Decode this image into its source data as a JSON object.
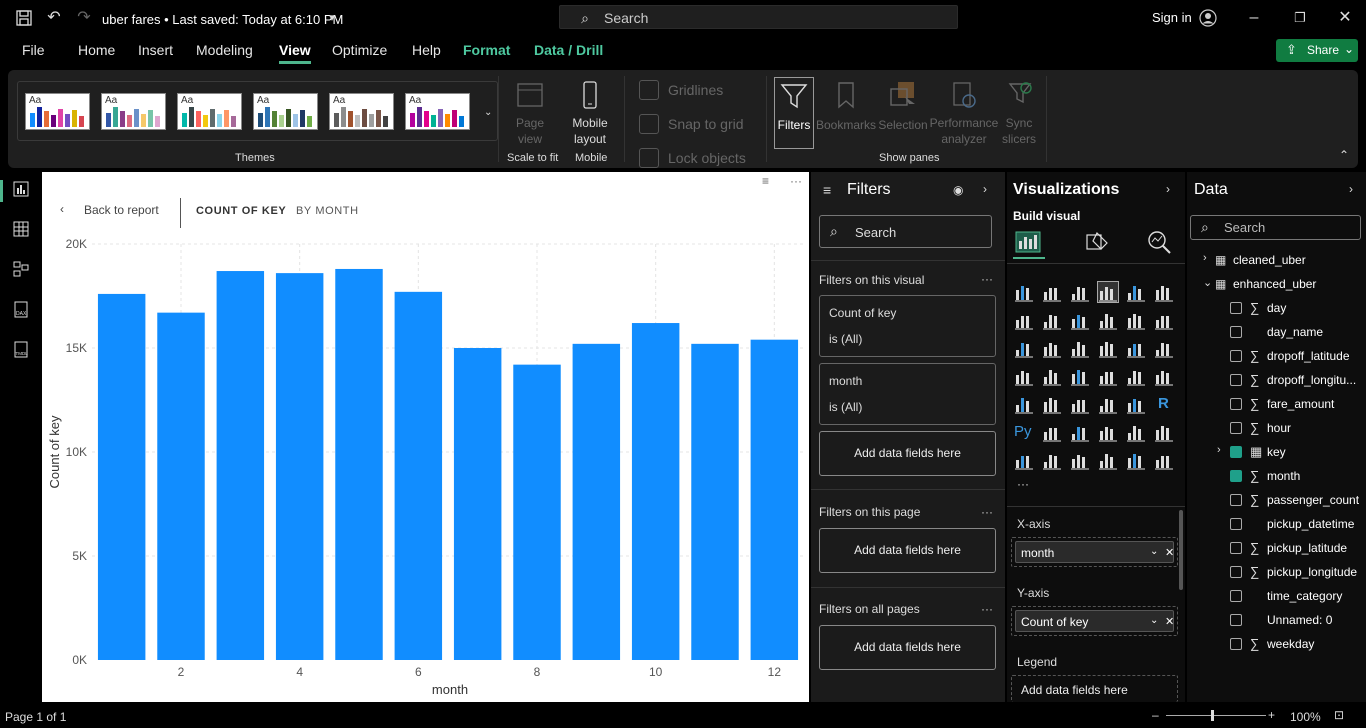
{
  "titlebar": {
    "doc_title": "uber fares • Last saved: Today at 6:10 PM",
    "search_placeholder": "Search",
    "sign_in": "Sign in"
  },
  "menu": {
    "items": [
      "File",
      "Home",
      "Insert",
      "Modeling",
      "View",
      "Optimize",
      "Help",
      "Format",
      "Data / Drill"
    ],
    "active": "View",
    "share": "Share"
  },
  "ribbon": {
    "themes_label": "Themes",
    "scale_label": "Scale to fit",
    "mobile_label": "Mobile",
    "show_panes_label": "Show panes",
    "page_view": "Page view",
    "mobile_layout": "Mobile layout",
    "gridlines": "Gridlines",
    "snap_to_grid": "Snap to grid",
    "lock_objects": "Lock objects",
    "filters": "Filters",
    "bookmarks": "Bookmarks",
    "selection": "Selection",
    "performance_analyzer": "Performance analyzer",
    "sync_slicers": "Sync slicers",
    "theme_swatch_text": "Aa",
    "accent": "#4eb58c"
  },
  "canvas": {
    "back_to_report": "Back to report",
    "title_measure": "COUNT OF KEY",
    "title_by": "BY MONTH"
  },
  "chart_data": {
    "type": "bar",
    "x": [
      1,
      2,
      3,
      4,
      5,
      6,
      7,
      8,
      9,
      10,
      11,
      12
    ],
    "values": [
      17600,
      16700,
      18700,
      18600,
      18800,
      17700,
      15000,
      14200,
      15200,
      16200,
      15200,
      15400
    ],
    "xticks": [
      "2",
      "4",
      "6",
      "8",
      "10",
      "12"
    ],
    "yticks": [
      "0K",
      "5K",
      "10K",
      "15K",
      "20K"
    ],
    "ylim": [
      0,
      20000
    ],
    "xlabel": "month",
    "ylabel": "Count of key",
    "bar_color": "#118dff",
    "grid": true
  },
  "filters": {
    "title": "Filters",
    "search_placeholder": "Search",
    "on_visual": "Filters on this visual",
    "on_page": "Filters on this page",
    "on_all_pages": "Filters on all pages",
    "cards": [
      {
        "name": "Count of key",
        "state": "is (All)"
      },
      {
        "name": "month",
        "state": "is (All)"
      }
    ],
    "add_fields": "Add data fields here",
    "more": "···"
  },
  "visualizations": {
    "title": "Visualizations",
    "build_visual": "Build visual",
    "more": "···",
    "x_axis_label": "X-axis",
    "x_axis_field": "month",
    "y_axis_label": "Y-axis",
    "y_axis_field": "Count of key",
    "legend_label": "Legend",
    "add_fields": "Add data fields here",
    "r_label": "R",
    "py_label": "Py",
    "icons": [
      "stacked-bar-icon",
      "stacked-column-icon",
      "clustered-bar-icon",
      "clustered-column-icon",
      "100-bar-icon",
      "100-column-icon",
      "line-chart-icon",
      "area-chart-icon",
      "stacked-area-icon",
      "ribbon-chart-icon",
      "line-clustered-icon",
      "line-stacked-icon",
      "combo-chart-icon",
      "waterfall-icon",
      "funnel-icon",
      "scatter-icon",
      "pie-icon",
      "donut-icon",
      "treemap-icon",
      "map-icon",
      "filled-map-icon",
      "azure-map-icon",
      "gauge-icon",
      "card-icon",
      "multirow-card-icon",
      "kpi-icon",
      "slicer-icon",
      "table-icon",
      "matrix-icon",
      "r-visual-icon",
      "python-visual-icon",
      "key-influencers-icon",
      "decomposition-tree-icon",
      "qna-icon",
      "paginated-report-icon",
      "goals-icon",
      "smart-narrative-icon",
      "card-new-icon",
      "custom-visual-icon",
      "power-apps-icon",
      "power-automate-icon",
      "more-visuals-icon"
    ]
  },
  "data": {
    "title": "Data",
    "search_placeholder": "Search",
    "tables": [
      {
        "name": "cleaned_uber",
        "expanded": false
      },
      {
        "name": "enhanced_uber",
        "expanded": true
      }
    ],
    "fields": [
      {
        "name": "day",
        "sigma": "∑",
        "checked": false
      },
      {
        "name": "day_name",
        "sigma": "",
        "checked": false
      },
      {
        "name": "dropoff_latitude",
        "sigma": "∑",
        "checked": false
      },
      {
        "name": "dropoff_longitu...",
        "sigma": "∑",
        "checked": false
      },
      {
        "name": "fare_amount",
        "sigma": "∑",
        "checked": false
      },
      {
        "name": "hour",
        "sigma": "∑",
        "checked": false
      },
      {
        "name": "key",
        "sigma": "▦",
        "checked": true
      },
      {
        "name": "month",
        "sigma": "∑",
        "checked": true
      },
      {
        "name": "passenger_count",
        "sigma": "∑",
        "checked": false
      },
      {
        "name": "pickup_datetime",
        "sigma": "",
        "checked": false
      },
      {
        "name": "pickup_latitude",
        "sigma": "∑",
        "checked": false
      },
      {
        "name": "pickup_longitude",
        "sigma": "∑",
        "checked": false
      },
      {
        "name": "time_category",
        "sigma": "",
        "checked": false
      },
      {
        "name": "Unnamed: 0",
        "sigma": "",
        "checked": false
      },
      {
        "name": "weekday",
        "sigma": "∑",
        "checked": false
      }
    ]
  },
  "status": {
    "page": "Page 1 of 1",
    "zoom": "100%"
  }
}
